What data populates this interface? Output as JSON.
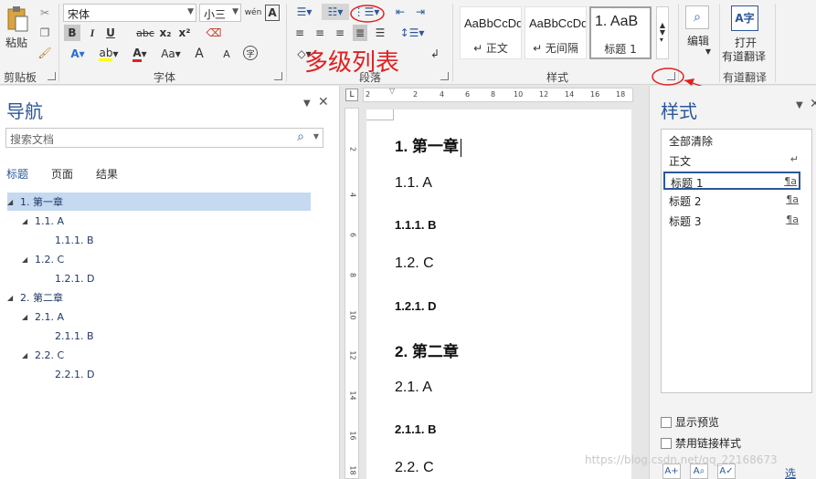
{
  "ribbon": {
    "clipboard": {
      "paste": "粘贴",
      "group": "剪贴板"
    },
    "font": {
      "name": "宋体",
      "size": "小三",
      "wen": "wén",
      "a_box": "A",
      "bold": "B",
      "italic": "I",
      "underline": "U",
      "strike": "abc",
      "sub": "x₂",
      "sup": "x²",
      "color_a": "A",
      "aa": "Aa",
      "grow": "A",
      "shrink": "A",
      "zi": "字",
      "group": "字体"
    },
    "paragraph": {
      "group": "段落"
    },
    "styles": {
      "items": [
        {
          "sample": "AaBbCcDd",
          "name": "↵ 正文"
        },
        {
          "sample": "AaBbCcDd",
          "name": "↵ 无间隔"
        },
        {
          "sample": "1.  AaB",
          "name": "标题 1"
        }
      ],
      "group": "样式"
    },
    "edit": {
      "label": "编辑"
    },
    "translate": {
      "label1": "打开",
      "label2": "有道翻译",
      "group": "有道翻译"
    }
  },
  "annotation": {
    "text": "多级列表"
  },
  "nav": {
    "title": "导航",
    "search_placeholder": "搜索文档",
    "tabs": [
      "标题",
      "页面",
      "结果"
    ],
    "tree": [
      {
        "label": "1. 第一章",
        "selected": true
      },
      {
        "label": "1.1. A"
      },
      {
        "label": "1.1.1. B"
      },
      {
        "label": "1.2. C"
      },
      {
        "label": "1.2.1. D"
      },
      {
        "label": "2. 第二章"
      },
      {
        "label": "2.1. A"
      },
      {
        "label": "2.1.1. B"
      },
      {
        "label": "2.2. C"
      },
      {
        "label": "2.2.1. D"
      }
    ]
  },
  "ruler": {
    "h_ticks": [
      "2",
      "2",
      "4",
      "6",
      "8",
      "10",
      "12",
      "14",
      "16",
      "18"
    ],
    "v_ticks": [
      "2",
      "4",
      "6",
      "8",
      "10",
      "12",
      "14",
      "16",
      "18"
    ]
  },
  "document": {
    "headings": [
      {
        "text": "1.  第一章",
        "level": 1
      },
      {
        "text": "1.1.  A",
        "level": 2
      },
      {
        "text": "1.1.1.  B",
        "level": 3
      },
      {
        "text": "1.2.  C",
        "level": 2
      },
      {
        "text": "1.2.1.  D",
        "level": 3
      },
      {
        "text": "2.  第二章",
        "level": 1
      },
      {
        "text": "2.1.  A",
        "level": 2
      },
      {
        "text": "2.1.1.  B",
        "level": 3
      },
      {
        "text": "2.2.  C",
        "level": 2
      }
    ]
  },
  "styles_pane": {
    "title": "样式",
    "items": [
      {
        "name": "全部清除",
        "mark": ""
      },
      {
        "name": "正文",
        "mark": "↵"
      },
      {
        "name": "标题 1",
        "mark": "¶a",
        "selected": true
      },
      {
        "name": "标题 2",
        "mark": "¶a"
      },
      {
        "name": "标题 3",
        "mark": "¶a"
      }
    ],
    "show_preview": "显示预览",
    "disable_linked": "禁用链接样式",
    "options": "选项..."
  },
  "watermark": "https://blog.csdn.net/qq_22168673",
  "colors": {
    "accent": "#2b579a",
    "annotation": "#e02020",
    "selection": "#c5d9f1"
  }
}
